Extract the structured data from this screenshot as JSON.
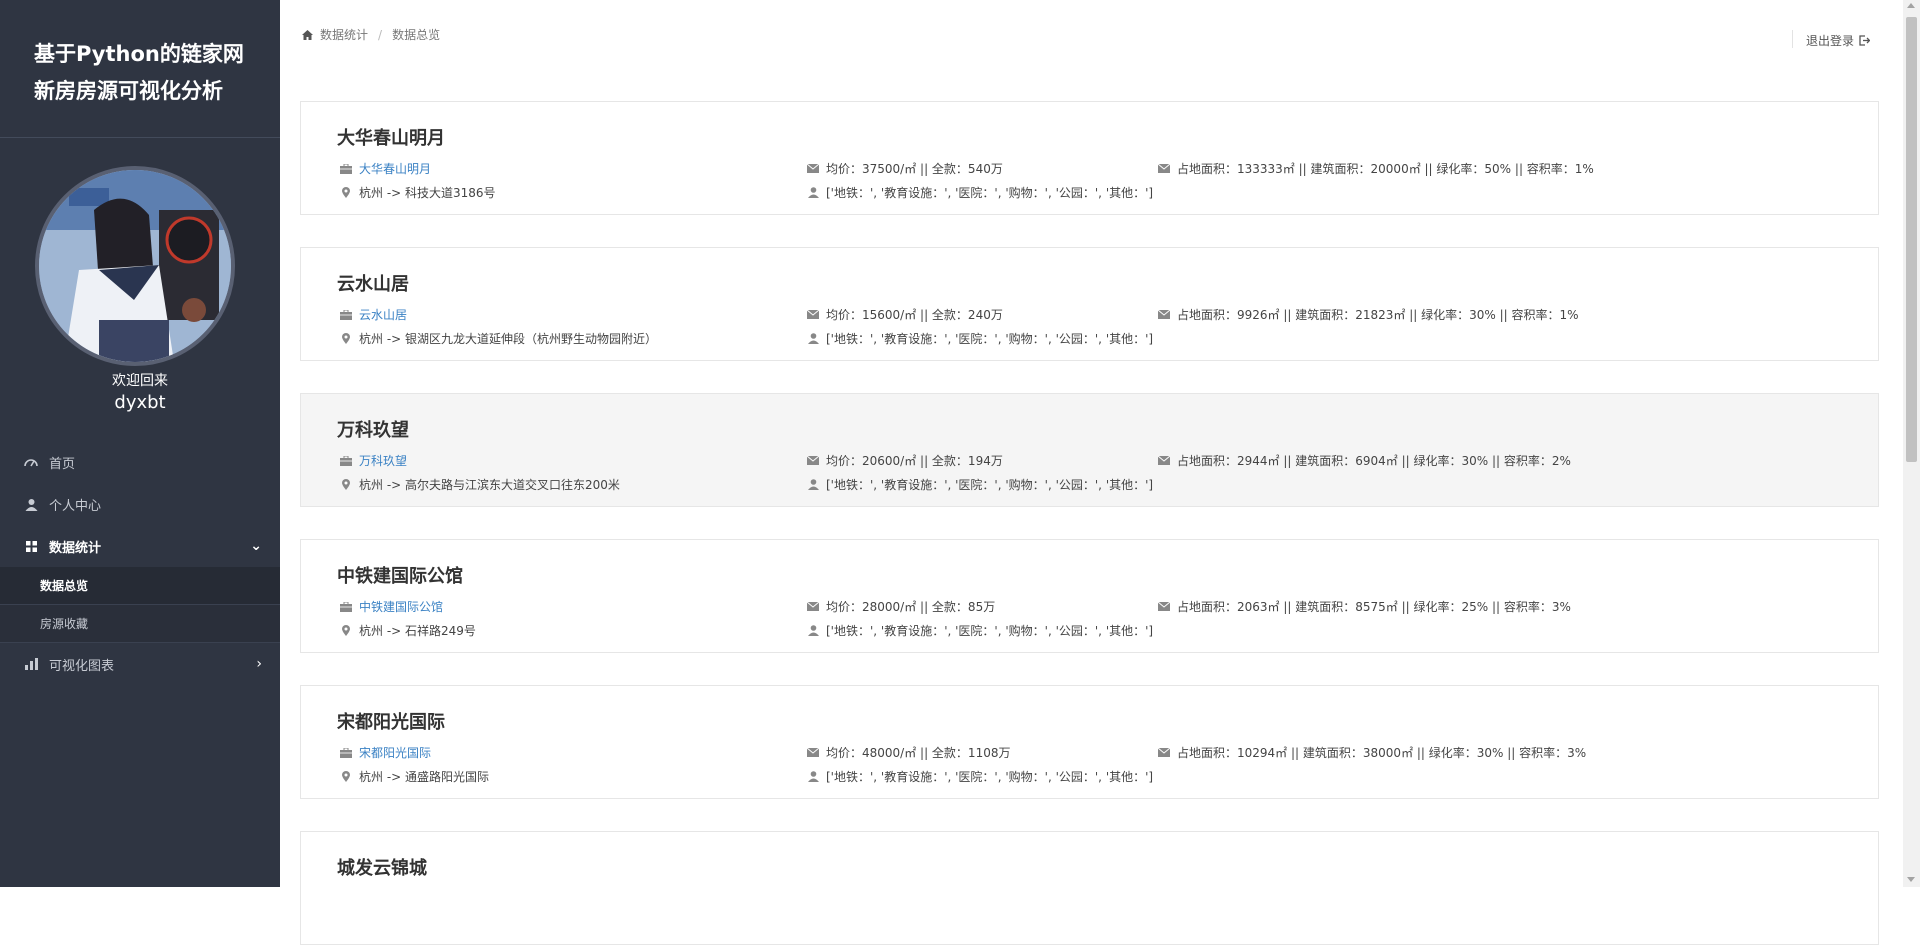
{
  "sidebar": {
    "title_line1": "基于Python的链家网",
    "title_line2": "新房房源可视化分析",
    "welcome": "欢迎回来",
    "username": "dyxbt",
    "nav": [
      {
        "label": "首页",
        "icon": "dashboard-icon"
      },
      {
        "label": "个人中心",
        "icon": "user-icon"
      },
      {
        "label": "数据统计",
        "icon": "grid-icon"
      },
      {
        "label": "可视化图表",
        "icon": "bar-chart-icon"
      }
    ],
    "sub_items": [
      {
        "label": "数据总览"
      },
      {
        "label": "房源收藏"
      }
    ]
  },
  "breadcrumb": {
    "home": "数据统计",
    "current": "数据总览"
  },
  "logout_label": "退出登录",
  "listings": [
    {
      "title": "大华春山明月",
      "name": "大华春山明月",
      "address": "杭州 -> 科技大道3186号",
      "price": "均价：37500/㎡ || 全款：540万",
      "facilities": "['地铁：', '教育设施：', '医院：', '购物：', '公园：', '其他：']",
      "area": "占地面积：133333㎡ || 建筑面积：20000㎡ || 绿化率：50% || 容积率：1%"
    },
    {
      "title": "云水山居",
      "name": "云水山居",
      "address": "杭州 -> 银湖区九龙大道延伸段（杭州野生动物园附近）",
      "price": "均价：15600/㎡ || 全款：240万",
      "facilities": "['地铁：', '教育设施：', '医院：', '购物：', '公园：', '其他：']",
      "area": "占地面积：9926㎡ || 建筑面积：21823㎡ || 绿化率：30% || 容积率：1%"
    },
    {
      "title": "万科玖望",
      "name": "万科玖望",
      "address": "杭州 -> 高尔夫路与江滨东大道交叉口往东200米",
      "price": "均价：20600/㎡ || 全款：194万",
      "facilities": "['地铁：', '教育设施：', '医院：', '购物：', '公园：', '其他：']",
      "area": "占地面积：2944㎡ || 建筑面积：6904㎡ || 绿化率：30% || 容积率：2%"
    },
    {
      "title": "中铁建国际公馆",
      "name": "中铁建国际公馆",
      "address": "杭州 -> 石祥路249号",
      "price": "均价：28000/㎡ || 全款：85万",
      "facilities": "['地铁：', '教育设施：', '医院：', '购物：', '公园：', '其他：']",
      "area": "占地面积：2063㎡ || 建筑面积：8575㎡ || 绿化率：25% || 容积率：3%"
    },
    {
      "title": "宋都阳光国际",
      "name": "宋都阳光国际",
      "address": "杭州 -> 通盛路阳光国际",
      "price": "均价：48000/㎡ || 全款：1108万",
      "facilities": "['地铁：', '教育设施：', '医院：', '购物：', '公园：', '其他：']",
      "area": "占地面积：10294㎡ || 建筑面积：38000㎡ || 绿化率：30% || 容积率：3%"
    },
    {
      "title": "城发云锦城"
    }
  ]
}
